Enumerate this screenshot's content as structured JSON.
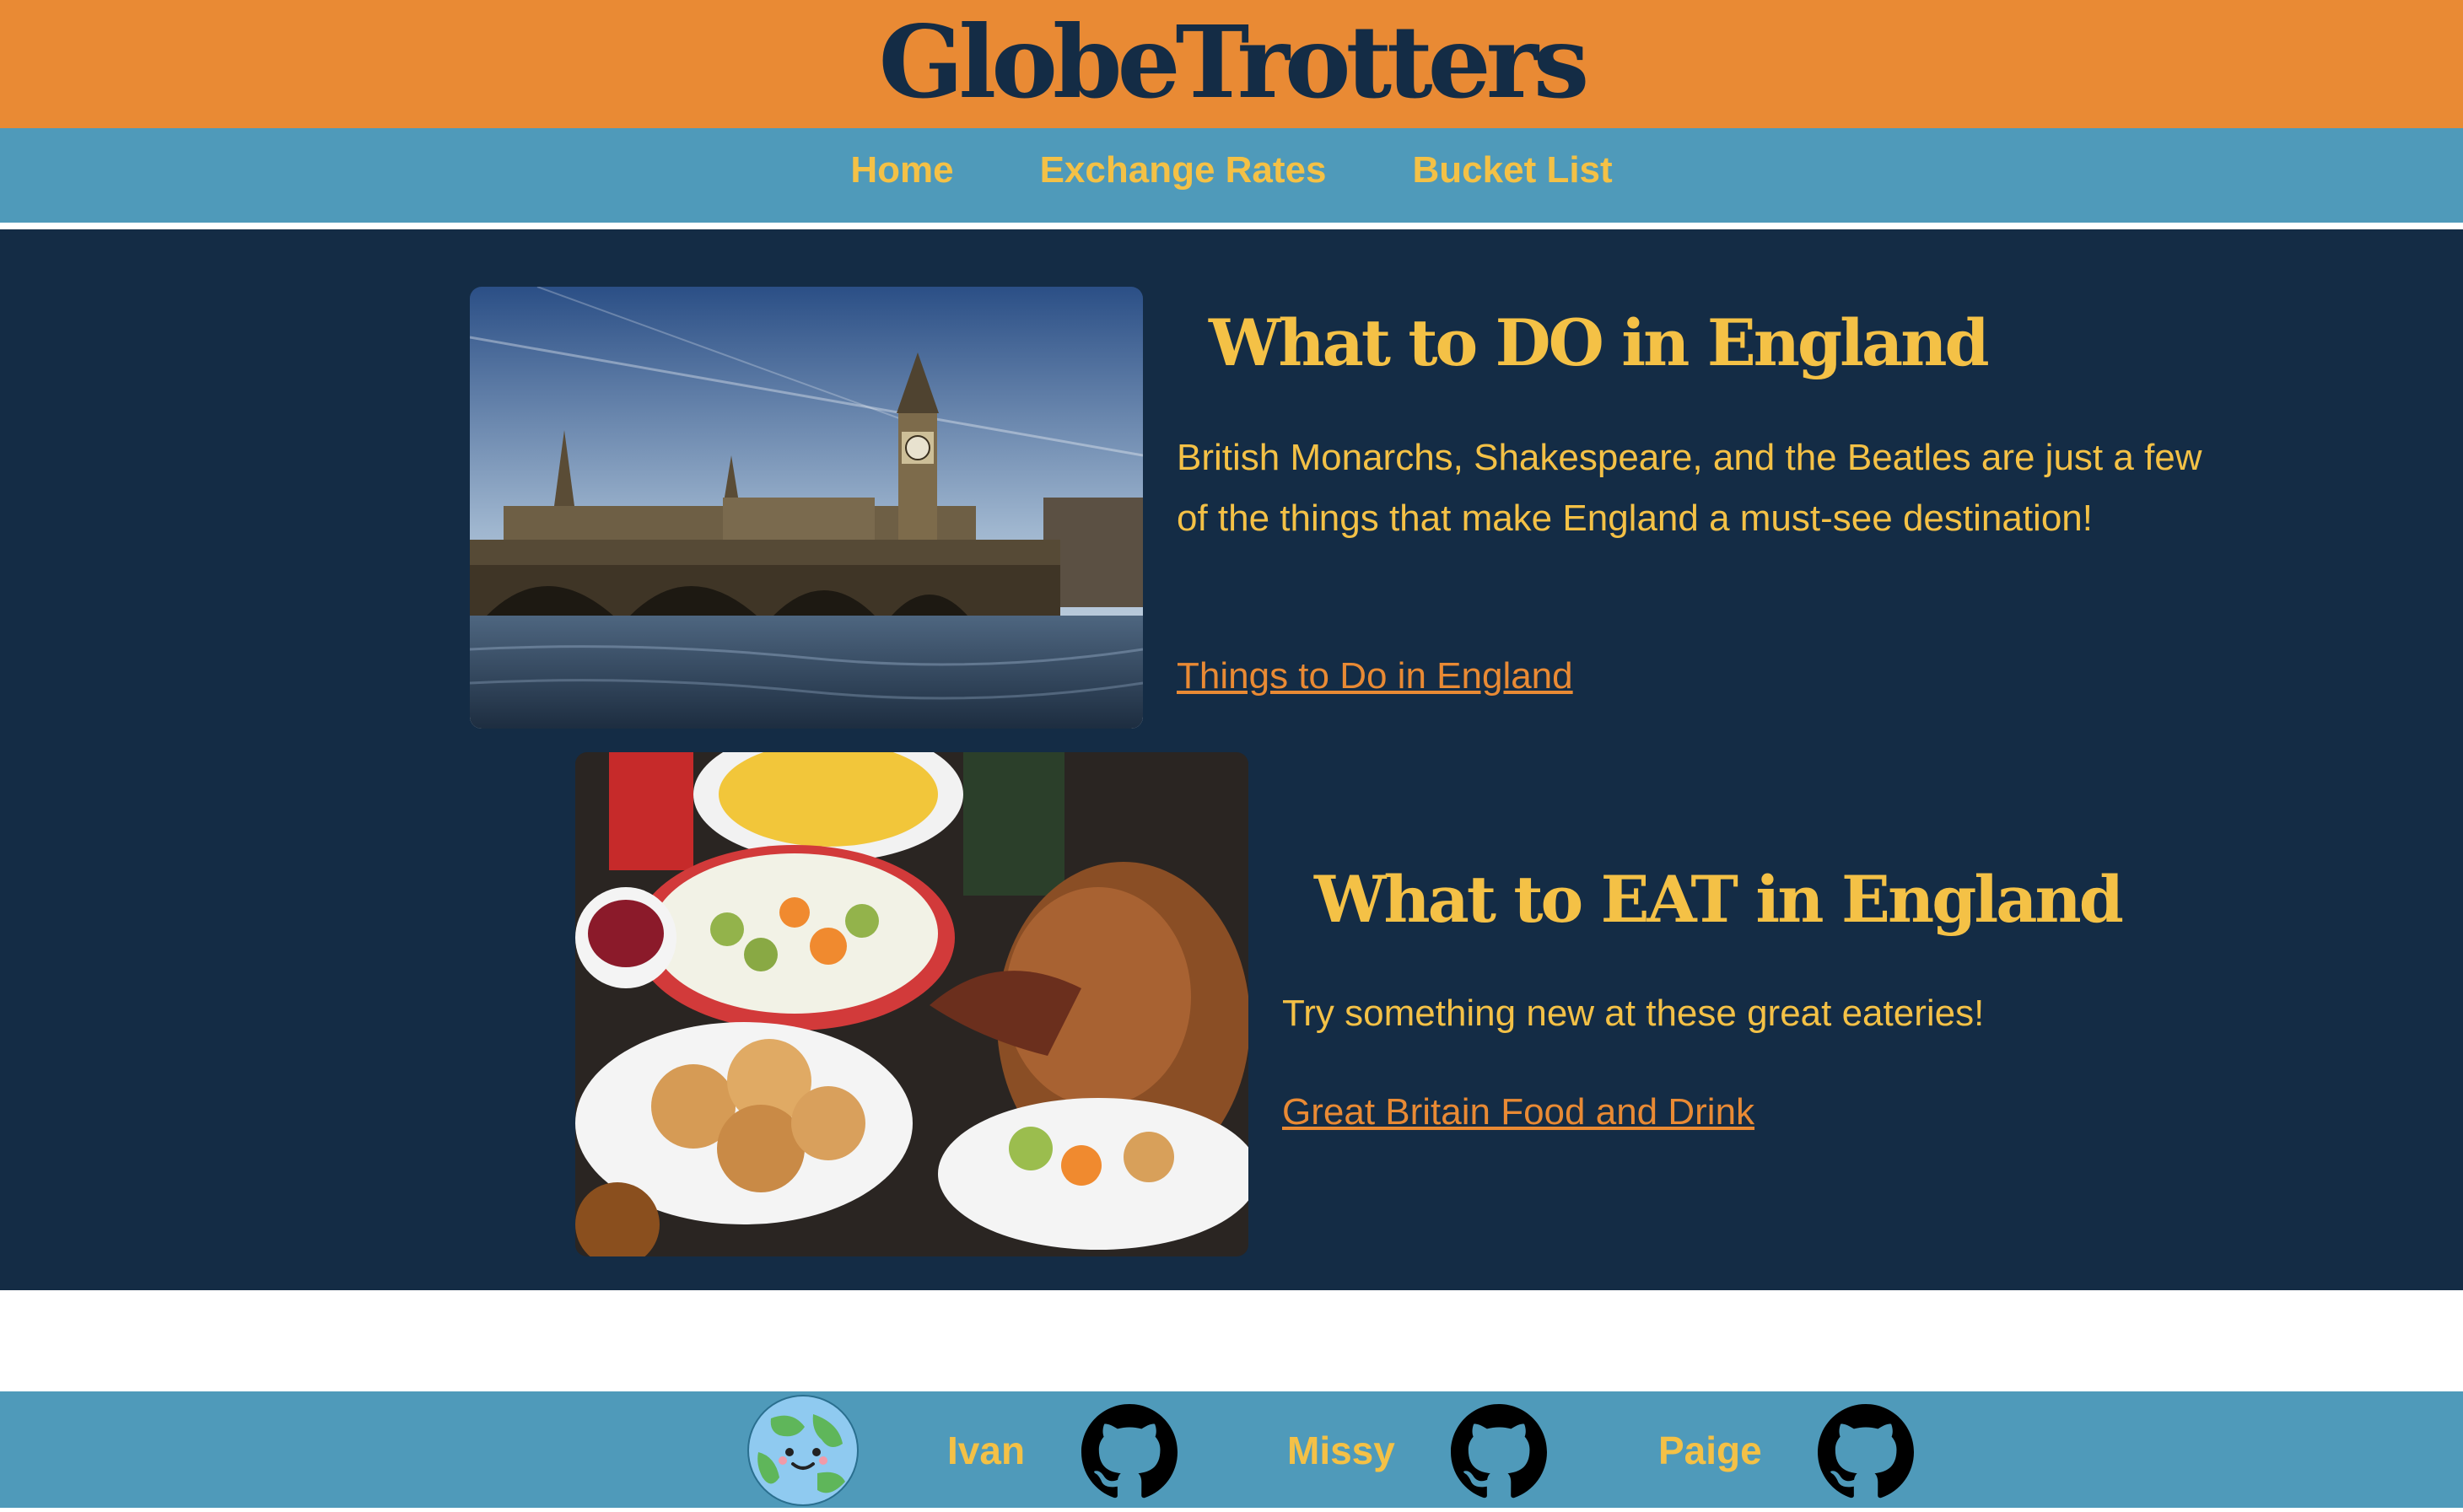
{
  "header": {
    "title": "GlobeTrotters"
  },
  "nav": {
    "items": [
      {
        "label": "Home"
      },
      {
        "label": "Exchange Rates"
      },
      {
        "label": "Bucket List"
      }
    ]
  },
  "sections": [
    {
      "title": "What to DO in England",
      "text": "British Monarchs, Shakespeare, and the Beatles are just a few of the things that make England a must-see destination!",
      "link": "Things to Do in England",
      "image": "westminster-bridge-photo"
    },
    {
      "title": "What to EAT in England",
      "text": "Try something new at these great eateries!",
      "link": "Great Britain Food and Drink",
      "image": "roast-dinner-photo"
    }
  ],
  "footer": {
    "logo": "globe-logo",
    "members": [
      {
        "name": "Ivan",
        "icon": "github-icon"
      },
      {
        "name": "Missy",
        "icon": "github-icon"
      },
      {
        "name": "Paige",
        "icon": "github-icon"
      }
    ]
  },
  "colors": {
    "header_bg": "#e98a34",
    "nav_bg": "#4f9aba",
    "main_bg": "#142c45",
    "accent_text": "#f4c146",
    "link": "#e98a34"
  }
}
